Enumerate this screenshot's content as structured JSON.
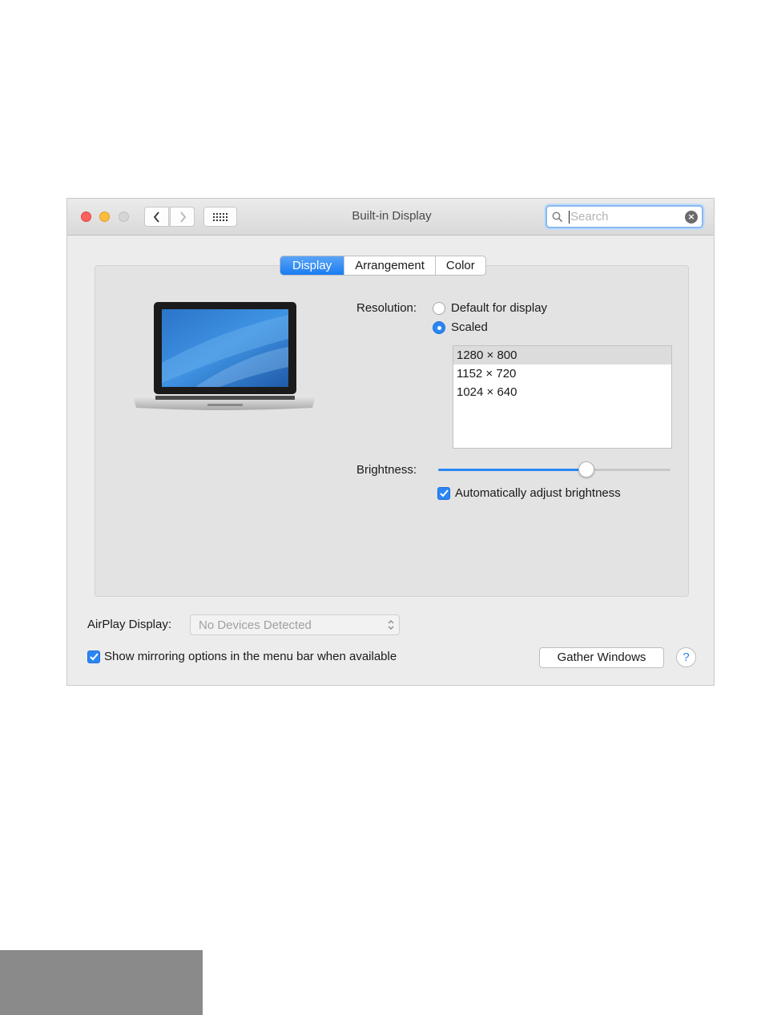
{
  "window": {
    "title": "Built-in Display",
    "search_placeholder": "Search"
  },
  "tabs": [
    {
      "label": "Display",
      "active": true
    },
    {
      "label": "Arrangement",
      "active": false
    },
    {
      "label": "Color",
      "active": false
    }
  ],
  "resolution": {
    "label": "Resolution:",
    "options": [
      {
        "label": "Default for display",
        "selected": false
      },
      {
        "label": "Scaled",
        "selected": true
      }
    ],
    "list": [
      "1280 × 800",
      "1152 × 720",
      "1024 × 640"
    ],
    "list_selected_index": 0
  },
  "brightness": {
    "label": "Brightness:",
    "level_fraction": 0.65,
    "auto_label": "Automatically adjust brightness",
    "auto_checked": true
  },
  "airplay": {
    "label": "AirPlay Display:",
    "value": "No Devices Detected"
  },
  "mirroring": {
    "label": "Show mirroring options in the menu bar when available",
    "checked": true
  },
  "buttons": {
    "gather": "Gather Windows",
    "help": "?"
  },
  "colors": {
    "accent": "#2a86f4",
    "close": "#fc615d",
    "minimize": "#fdbc40",
    "zoom_disabled": "#d5d5d5"
  },
  "icons": {
    "back": "chevron-left-icon",
    "forward": "chevron-right-icon",
    "grid": "grid-icon",
    "search": "magnifier-icon",
    "clear": "clear-x-icon",
    "select": "up-down-arrows-icon",
    "check": "checkmark-icon"
  }
}
